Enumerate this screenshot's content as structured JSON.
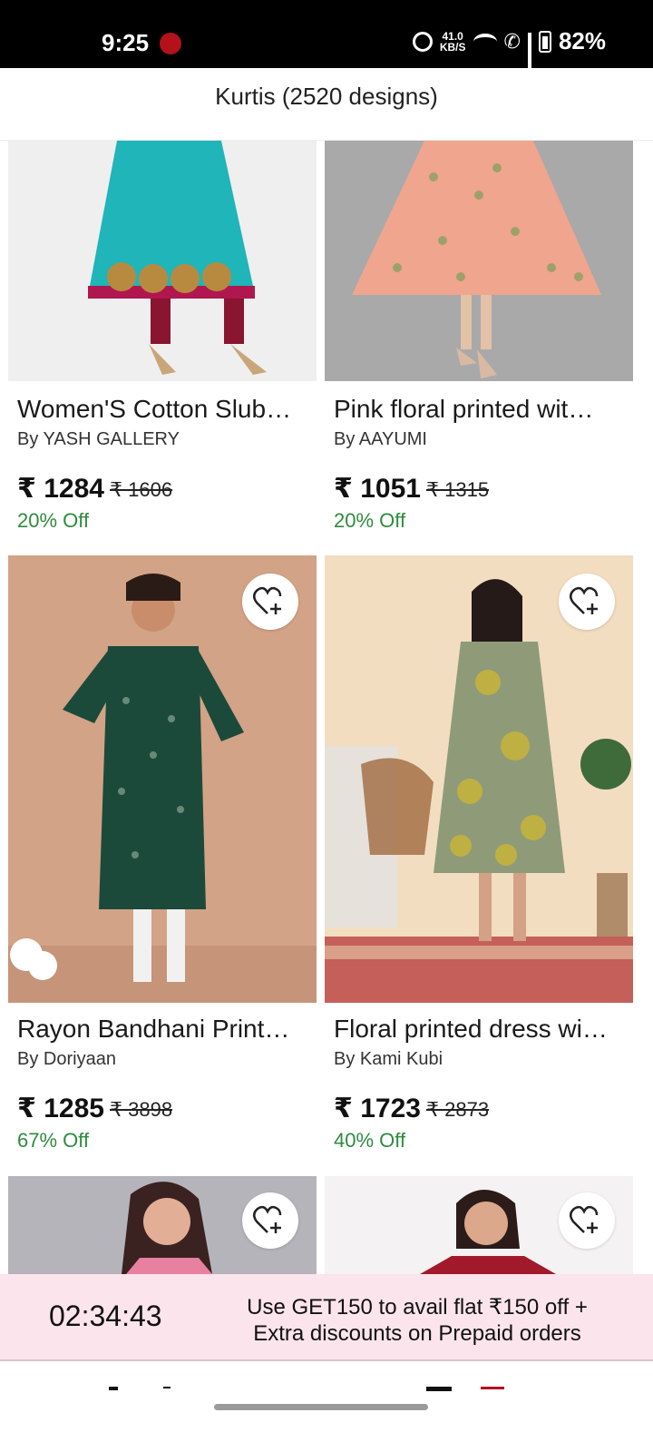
{
  "status_bar": {
    "time": "9:25",
    "speed_top": "41.0",
    "speed_unit": "KB/S",
    "battery": "82%",
    "icons": [
      "red-app-icon",
      "alarm-icon",
      "wifi-icon",
      "call-icon",
      "signal-icon",
      "battery-icon"
    ]
  },
  "header": {
    "title": "Kurtis (2520 designs)"
  },
  "products": [
    {
      "title": "Women'S Cotton Slub…",
      "brand": "By YASH GALLERY",
      "price": "₹ 1284",
      "mrp": "₹ 1606",
      "off": "20% Off"
    },
    {
      "title": "Pink floral printed wit…",
      "brand": "By AAYUMI",
      "price": "₹ 1051",
      "mrp": "₹ 1315",
      "off": "20% Off"
    },
    {
      "title": "Rayon Bandhani Print…",
      "brand": "By Doriyaan",
      "price": "₹ 1285",
      "mrp": "₹ 3898",
      "off": "67% Off"
    },
    {
      "title": "Floral printed dress wi…",
      "brand": "By Kami Kubi",
      "price": "₹ 1723",
      "mrp": "₹ 2873",
      "off": "40% Off"
    }
  ],
  "promo": {
    "timer": "02:34:43",
    "line1": "Use GET150 to avail flat ₹150 off +",
    "line2": "Extra discounts on Prepaid orders"
  },
  "colors": {
    "discount": "#2e8b3e",
    "promo_bg": "#fce4ec"
  }
}
